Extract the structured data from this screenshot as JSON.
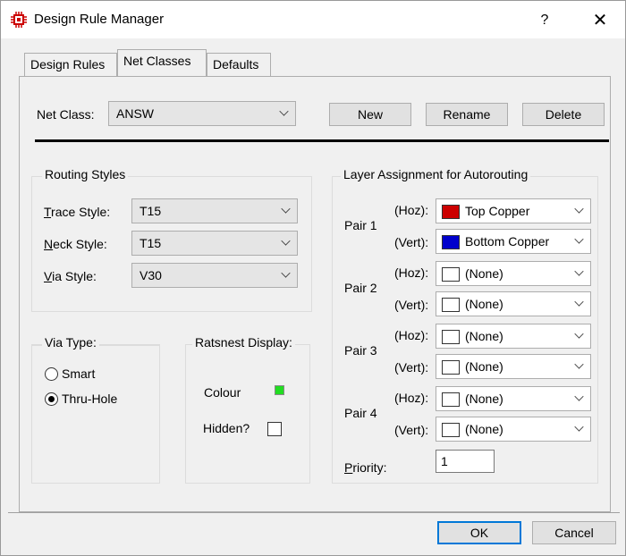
{
  "window": {
    "title": "Design Rule Manager",
    "help": "?",
    "close": "✕"
  },
  "tabs": [
    "Design Rules",
    "Net Classes",
    "Defaults"
  ],
  "net_class": {
    "label": "Net Class:",
    "value": "ANSW"
  },
  "buttons": {
    "new": "New",
    "rename": "Rename",
    "delete": "Delete",
    "ok": "OK",
    "cancel": "Cancel"
  },
  "routing": {
    "title": "Routing Styles",
    "trace": {
      "label_u": "T",
      "label_rest": "race Style:",
      "value": "T15"
    },
    "neck": {
      "label_u": "N",
      "label_rest": "eck Style:",
      "value": "T15"
    },
    "via": {
      "label_u": "V",
      "label_rest": "ia Style:",
      "value": "V30"
    }
  },
  "via_type": {
    "title": "Via Type:",
    "smart": "Smart",
    "thru": "Thru-Hole",
    "selected": "Thru-Hole"
  },
  "ratsnest": {
    "title": "Ratsnest Display:",
    "colour_label": "Colour",
    "colour": "#22dd22",
    "hidden_label": "Hidden?",
    "hidden": false
  },
  "layers": {
    "title": "Layer Assignment for Autorouting",
    "hoz": "(Hoz):",
    "vert": "(Vert):",
    "pairs": [
      {
        "name": "Pair 1",
        "hoz": "Top Copper",
        "hoz_color": "#cc0000",
        "vert": "Bottom Copper",
        "vert_color": "#0000cc"
      },
      {
        "name": "Pair 2",
        "hoz": "(None)",
        "hoz_color": "#ffffff",
        "vert": "(None)",
        "vert_color": "#ffffff"
      },
      {
        "name": "Pair 3",
        "hoz": "(None)",
        "hoz_color": "#ffffff",
        "vert": "(None)",
        "vert_color": "#ffffff"
      },
      {
        "name": "Pair 4",
        "hoz": "(None)",
        "hoz_color": "#ffffff",
        "vert": "(None)",
        "vert_color": "#ffffff"
      }
    ],
    "priority_u": "P",
    "priority_rest": "riority:",
    "priority": "1"
  }
}
